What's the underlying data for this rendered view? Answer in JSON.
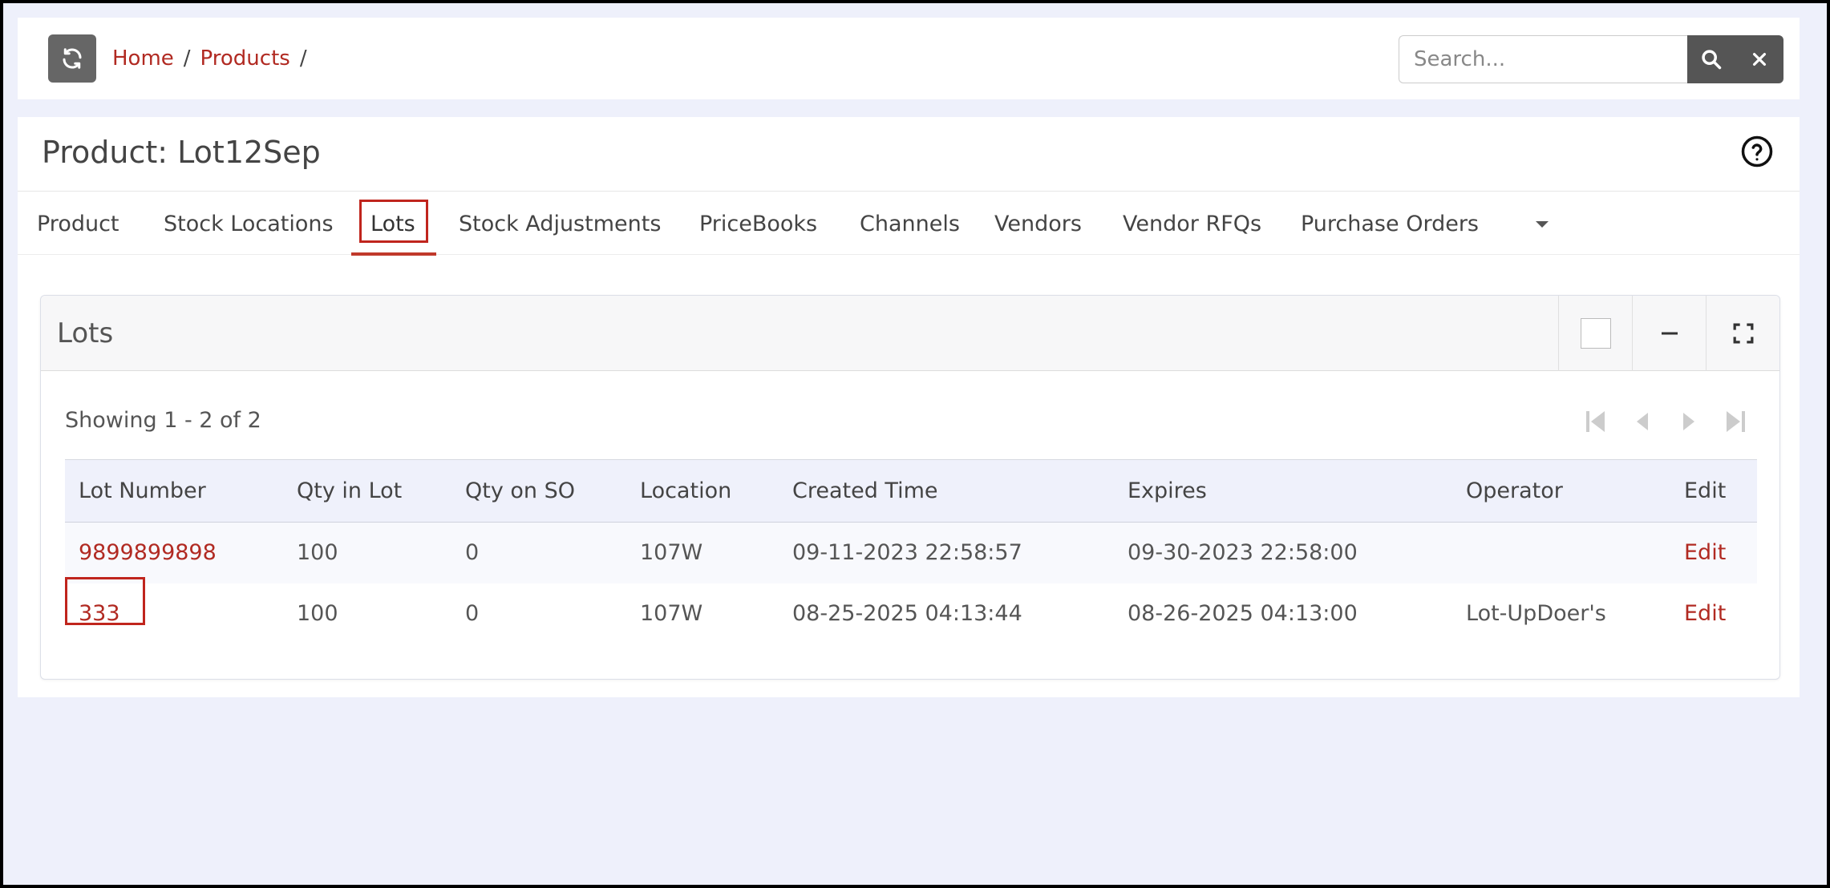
{
  "breadcrumb": {
    "home": "Home",
    "products": "Products",
    "sep": "/"
  },
  "search": {
    "placeholder": "Search..."
  },
  "page": {
    "title": "Product: Lot12Sep"
  },
  "tabs": [
    {
      "label": "Product"
    },
    {
      "label": "Stock Locations"
    },
    {
      "label": "Lots"
    },
    {
      "label": "Stock Adjustments"
    },
    {
      "label": "PriceBooks"
    },
    {
      "label": "Channels"
    },
    {
      "label": "Vendors"
    },
    {
      "label": "Vendor RFQs"
    },
    {
      "label": "Purchase Orders"
    }
  ],
  "panel": {
    "title": "Lots",
    "showing": "Showing 1 - 2 of 2"
  },
  "table": {
    "columns": [
      "Lot Number",
      "Qty in Lot",
      "Qty on SO",
      "Location",
      "Created Time",
      "Expires",
      "Operator",
      "Edit"
    ],
    "rows": [
      {
        "lot": "9899899898",
        "qty": "100",
        "qty_so": "0",
        "location": "107W",
        "created": "09-11-2023 22:58:57",
        "expires": "09-30-2023 22:58:00",
        "operator": "",
        "edit": "Edit"
      },
      {
        "lot": "333",
        "qty": "100",
        "qty_so": "0",
        "location": "107W",
        "created": "08-25-2025 04:13:44",
        "expires": "08-26-2025 04:13:00",
        "operator": "Lot-UpDoer's",
        "edit": "Edit"
      }
    ]
  },
  "colors": {
    "accent": "#b12a22",
    "highlight": "#c0251d",
    "button": "#555555"
  }
}
